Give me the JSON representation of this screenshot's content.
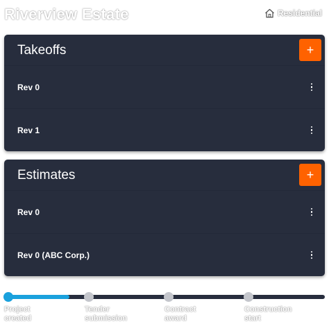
{
  "header": {
    "project_title": "Riverview Estate",
    "project_type": "Residential",
    "project_type_icon": "home-icon"
  },
  "takeoffs": {
    "title": "Takeoffs",
    "add_label": "+",
    "rows": [
      {
        "label": "Rev 0"
      },
      {
        "label": "Rev 1"
      }
    ]
  },
  "estimates": {
    "title": "Estimates",
    "add_label": "+",
    "rows": [
      {
        "label": "Rev 0"
      },
      {
        "label": "Rev 0 (ABC Corp.)"
      }
    ]
  },
  "timeline": {
    "stages": [
      {
        "label": "Project\ncreated",
        "state": "complete"
      },
      {
        "label": "Tender\nsubmission",
        "state": "pending"
      },
      {
        "label": "Contract\naward",
        "state": "pending"
      },
      {
        "label": "Construction\nstart",
        "state": "pending"
      }
    ]
  },
  "colors": {
    "card_bg": "#272d3d",
    "accent_orange": "#ff6200",
    "progress_blue": "#1aa1dd",
    "node_inactive": "#c4c6cc"
  }
}
